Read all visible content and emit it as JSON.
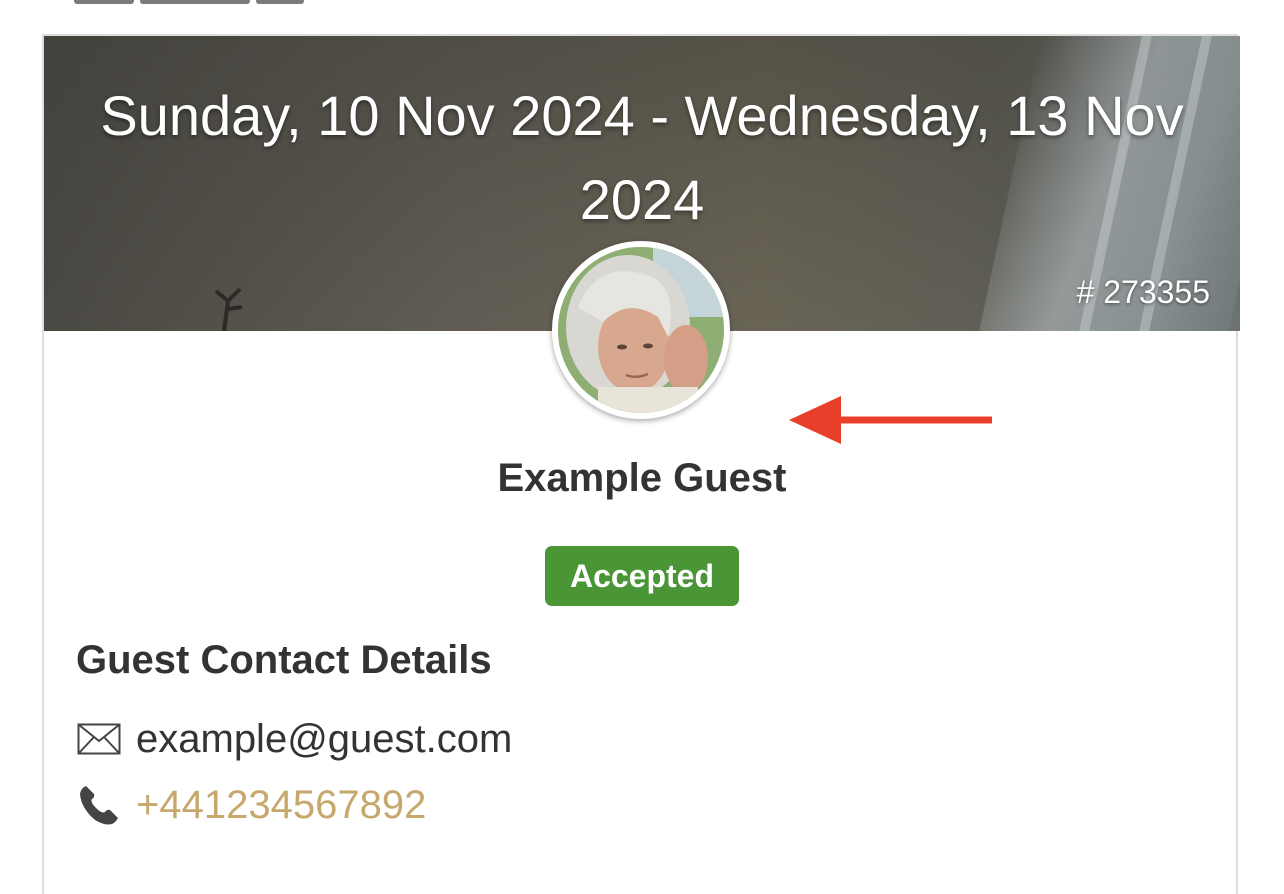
{
  "booking": {
    "date_range": "Sunday, 10 Nov 2024 - Wednesday, 13 Nov 2024",
    "reference": "# 273355"
  },
  "guest": {
    "name": "Example Guest",
    "status": "Accepted",
    "avatar_icon": "guest-portrait"
  },
  "contact": {
    "heading": "Guest Contact Details",
    "email": "example@guest.com",
    "email_icon": "envelope-icon",
    "phone": "+441234567892",
    "phone_icon": "phone-icon"
  },
  "colors": {
    "status_accepted": "#4a9535",
    "phone_link": "#c6a86d",
    "annotation_arrow": "#e8402a"
  }
}
